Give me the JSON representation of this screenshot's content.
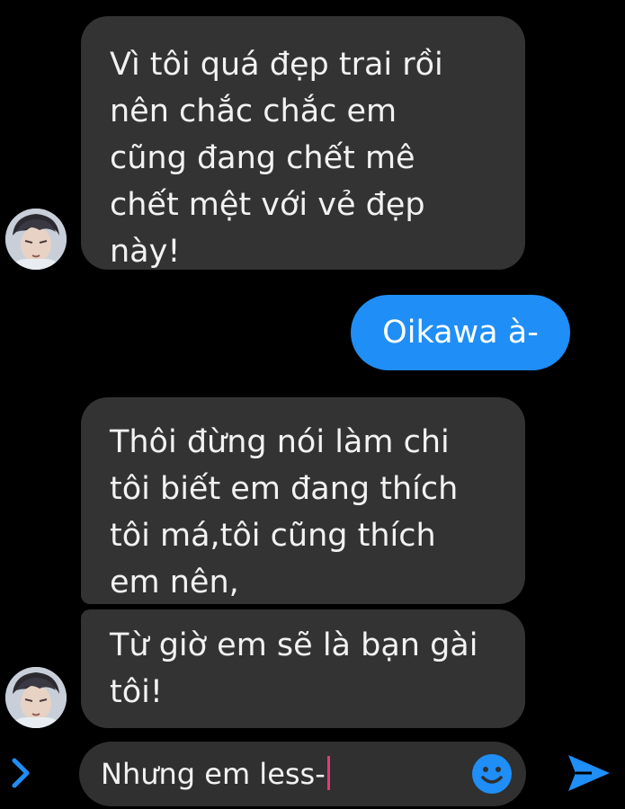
{
  "messages": [
    {
      "direction": "incoming",
      "lines": [
        "Vì tôi quá đẹp trai rồi",
        "nên chắc chắc em",
        "cũng đang chết mê",
        "chết mệt với vẻ đẹp",
        "này!"
      ]
    },
    {
      "direction": "outgoing",
      "lines": [
        "Oikawa à-"
      ]
    },
    {
      "direction": "incoming",
      "lines": [
        "Thôi đừng nói làm chi",
        "tôi biết em đang thích",
        "tôi má,tôi cũng thích",
        "em nên,"
      ]
    },
    {
      "direction": "incoming",
      "lines": [
        "Từ giờ em sẽ là bạn gài",
        "tôi!"
      ]
    }
  ],
  "composer": {
    "value": "Nhưng em less-"
  },
  "icons": {
    "expand": "chevron-right-icon",
    "emoji": "emoji-smile-icon",
    "send": "send-icon",
    "avatar": "avatar"
  },
  "colors": {
    "background": "#000000",
    "incoming_bubble": "#333333",
    "outgoing_bubble": "#1f8ef6",
    "accent": "#1f8ef6",
    "caret": "#e6397a"
  }
}
